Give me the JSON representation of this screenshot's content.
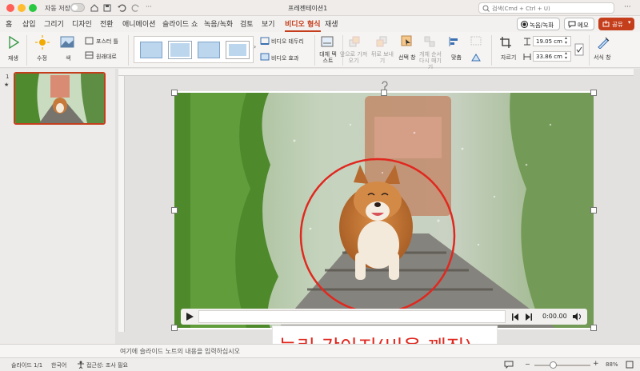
{
  "window": {
    "title": "프레젠테이션1",
    "autosave_label": "자동 저장",
    "search_placeholder": "검색(Cmd + Ctrl + U)"
  },
  "menu": {
    "tabs": [
      "홈",
      "삽입",
      "그리기",
      "디자인",
      "전환",
      "애니메이션",
      "슬라이드 쇼",
      "녹음/녹화",
      "검토",
      "보기",
      "비디오 형식",
      "재생"
    ],
    "active": "비디오 형식",
    "record_label": "녹음/녹화",
    "memo_label": "메모",
    "share_label": "공유"
  },
  "ribbon": {
    "play_label": "재생",
    "correct_label": "수정",
    "color_label": "색",
    "poster_label": "포스터 틀",
    "reset_label": "원래대로",
    "border_label": "비디오 테두리",
    "effects_label": "비디오 효과",
    "alt_text_label": "대체 텍스트",
    "send_back_label": "앞으로 가져오기",
    "bring_front_label": "뒤로 보내기",
    "selection_pane_label": "선택 창",
    "reorder_label": "개체 순서 다시 매기기",
    "align_label": "맞춤",
    "crop_label": "자르기",
    "height_value": "19.05 cm",
    "width_value": "33.86 cm",
    "format_pane_label": "서식 창"
  },
  "slides": {
    "number": "1",
    "star": "★"
  },
  "video": {
    "time": "0:00.00"
  },
  "caption": "눌린 강아지(비율 깨짐)",
  "notes_placeholder": "여기에 슬라이드 노트의 내용을 입력하십시오",
  "status": {
    "slide": "슬라이드 1/1",
    "language": "한국어",
    "accessibility": "접근성: 조사 필요",
    "zoom": "88%"
  },
  "colors": {
    "accent": "#c43e1c",
    "share": "#c43e1c",
    "circle": "#e0281f"
  }
}
